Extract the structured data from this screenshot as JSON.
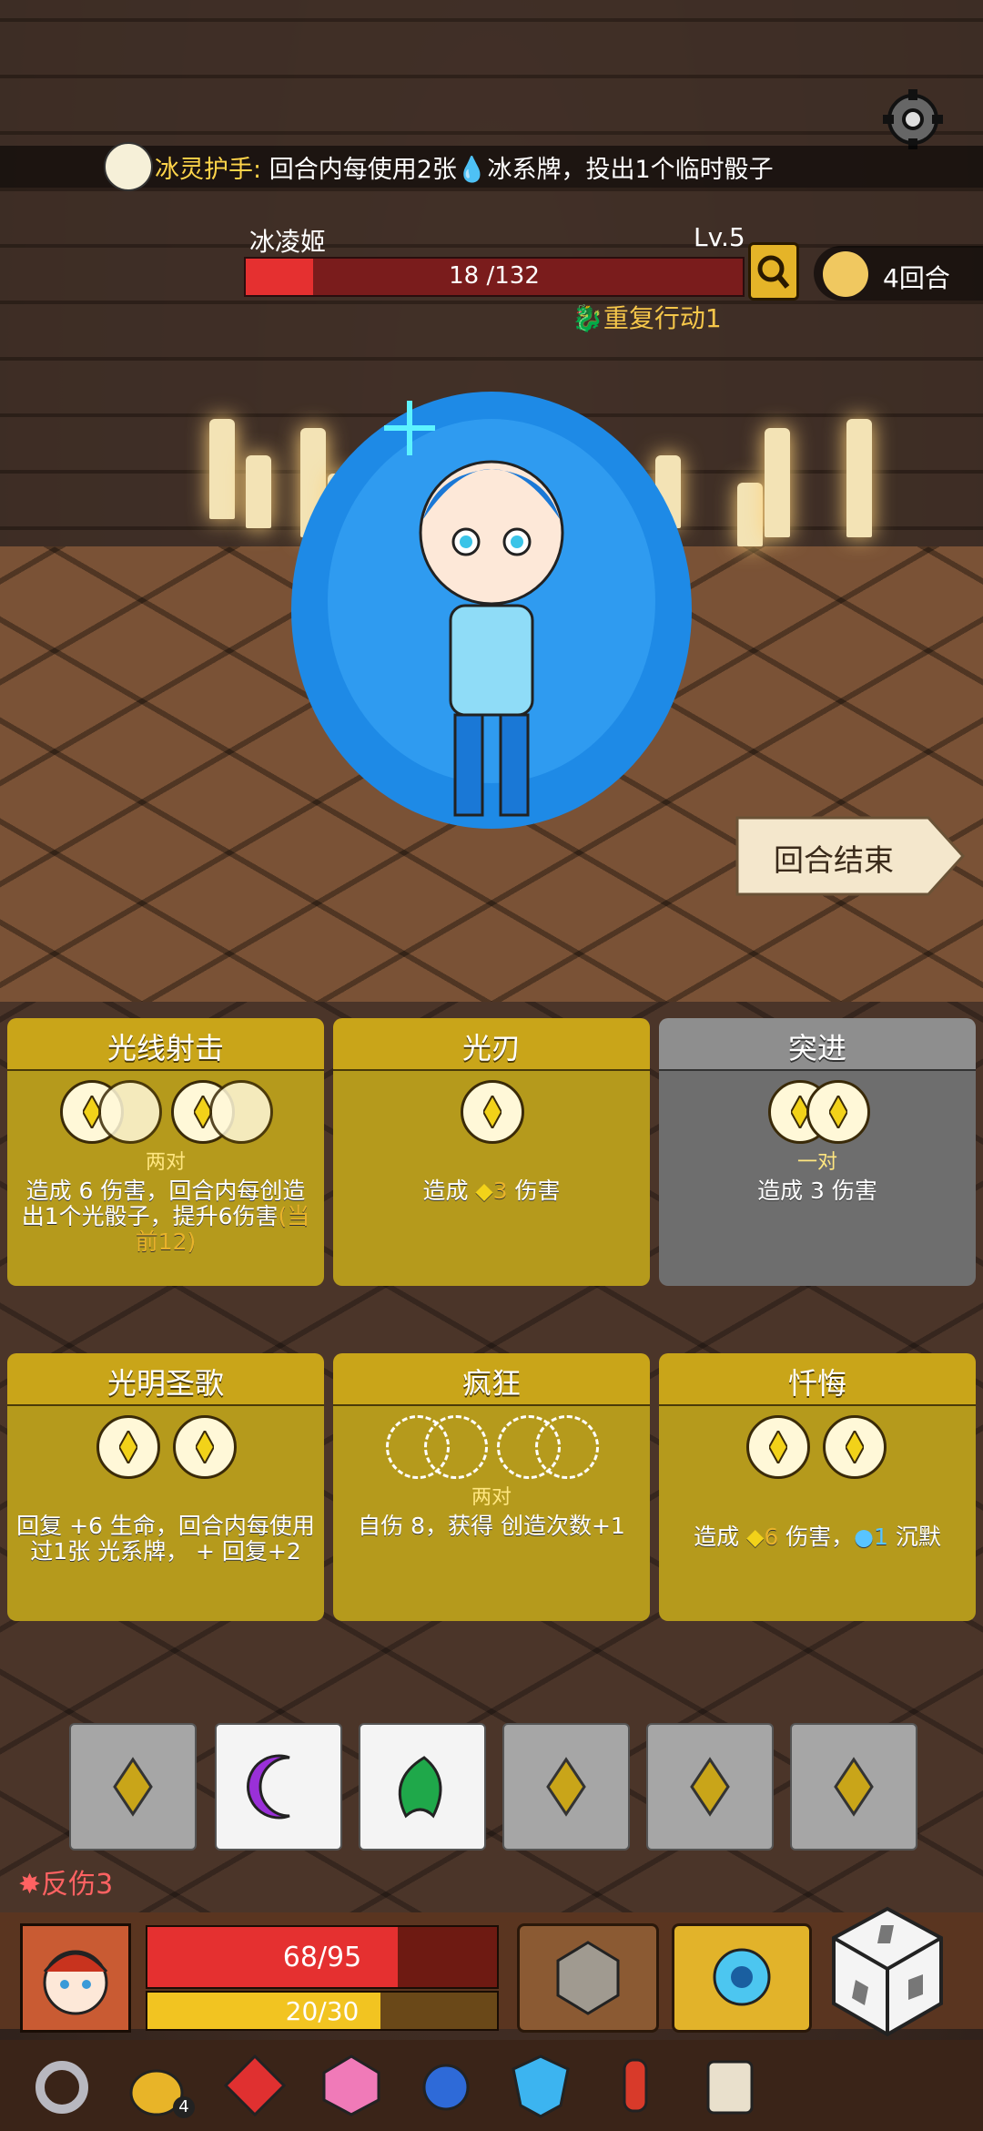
{
  "buff": {
    "name": "冰灵护手:",
    "text_before": " 回合内每使用2张",
    "text_after": "冰系牌，投出1个临时骰子"
  },
  "enemy": {
    "name": "冰凌姬",
    "level": "Lv.5",
    "hp_text": "18 /132",
    "hp_fraction": 0.136,
    "intent": "重复行动1"
  },
  "turns": "4回合",
  "end_turn_label": "回合结束",
  "cards": [
    {
      "title": "光线射击",
      "req": "两对",
      "desc": "造成 6 伤害，回合内每创造出1个光骰子，提升6伤害",
      "extra": "(当前12)",
      "style": "gold"
    },
    {
      "title": "光刃",
      "req": "",
      "desc_pre": "造成 ",
      "desc_val": "3",
      "desc_post": " 伤害",
      "style": "gold"
    },
    {
      "title": "突进",
      "req": "一对",
      "desc": "造成 3 伤害",
      "style": "grey"
    },
    {
      "title": "光明圣歌",
      "req": "",
      "desc": "回复 +6 生命，回合内每使用过1张 光系牌， + 回复+2",
      "style": "gold"
    },
    {
      "title": "疯狂",
      "req": "两对",
      "desc": "自伤 8，获得 创造次数+1",
      "style": "gold"
    },
    {
      "title": "忏悔",
      "req": "",
      "desc_pre": "造成 ",
      "desc_val": "6",
      "desc_mid": " 伤害，",
      "desc_val2": "1",
      "desc_post": " 沉默",
      "style": "gold"
    }
  ],
  "dice_tray": [
    "light",
    "moon",
    "leaf",
    "light",
    "light",
    "light"
  ],
  "status": {
    "thorns": "反伤3"
  },
  "player": {
    "hp_text": "68/95",
    "hp_fraction": 0.716,
    "shield_text": "20/30",
    "shield_fraction": 0.667
  },
  "relics": [
    {
      "icon": "ring-icon"
    },
    {
      "icon": "money-bag-icon",
      "count": "4"
    },
    {
      "icon": "red-gem-icon"
    },
    {
      "icon": "pink-d20-icon"
    },
    {
      "icon": "spiked-blue-orb-icon"
    },
    {
      "icon": "blue-shield-gem-icon"
    },
    {
      "icon": "red-potion-icon"
    },
    {
      "icon": "scroll-icon"
    }
  ],
  "colors": {
    "gold": "#c9a519",
    "grey": "#8e8e8e",
    "hp": "#e53030",
    "shield": "#f2c421"
  }
}
